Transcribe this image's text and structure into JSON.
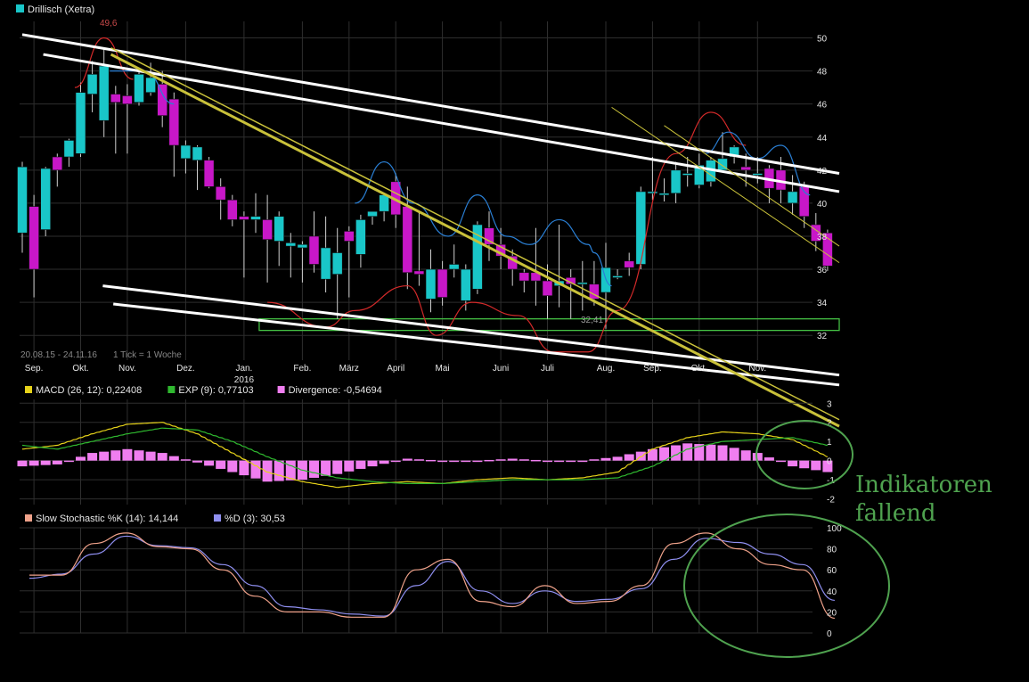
{
  "colors": {
    "background": "#000000",
    "grid": "#2e2e2e",
    "candle_up": "#19c6c8",
    "candle_down": "#c817c8",
    "wick": "#cfcfcf",
    "trendline_white": "#ffffff",
    "trendline_yellow": "#c9c13a",
    "support_box": "#44c044",
    "cycle_red": "#d42a2a",
    "cycle_blue": "#2a7fd4",
    "macd": "#e6d21a",
    "exp": "#2fb82f",
    "divergence": "#f07ef0",
    "stoch_k": "#f0a28a",
    "stoch_d": "#8f8ff0",
    "annotation": "#4fa24f"
  },
  "chart_data": [
    {
      "type": "candlestick",
      "title": "Drillisch (Xetra)",
      "legend_swatch_color": "#19c6c8",
      "period_label": "20.08.15 - 24.11.16",
      "tick_label": "1 Tick = 1 Woche",
      "price_note": "32,41",
      "high_note": "49,6",
      "ylim": [
        30.5,
        51
      ],
      "yticks": [
        32,
        34,
        36,
        38,
        40,
        42,
        44,
        46,
        48,
        50
      ],
      "xlabels": [
        {
          "week": 1,
          "label": "Sep."
        },
        {
          "week": 5,
          "label": "Okt."
        },
        {
          "week": 9,
          "label": "Nov."
        },
        {
          "week": 14,
          "label": "Dez."
        },
        {
          "week": 19,
          "label": "Jan."
        },
        {
          "week": 24,
          "label": "Feb."
        },
        {
          "week": 28,
          "label": "März"
        },
        {
          "week": 32,
          "label": "April"
        },
        {
          "week": 36,
          "label": "Mai"
        },
        {
          "week": 41,
          "label": "Juni"
        },
        {
          "week": 45,
          "label": "Juli"
        },
        {
          "week": 50,
          "label": "Aug."
        },
        {
          "week": 54,
          "label": "Sep."
        },
        {
          "week": 58,
          "label": "Okt."
        },
        {
          "week": 63,
          "label": "Nov."
        }
      ],
      "year_label": {
        "week": 19,
        "label": "2016"
      },
      "candles": [
        {
          "o": 38.2,
          "h": 42.5,
          "l": 37.0,
          "c": 42.2
        },
        {
          "o": 39.8,
          "h": 40.5,
          "l": 34.3,
          "c": 36.0
        },
        {
          "o": 38.4,
          "h": 42.2,
          "l": 38.0,
          "c": 42.1
        },
        {
          "o": 42.8,
          "h": 43.0,
          "l": 41.0,
          "c": 42.0
        },
        {
          "o": 42.8,
          "h": 43.9,
          "l": 42.2,
          "c": 43.8
        },
        {
          "o": 43.0,
          "h": 47.3,
          "l": 42.8,
          "c": 46.7
        },
        {
          "o": 46.6,
          "h": 48.6,
          "l": 45.5,
          "c": 47.8
        },
        {
          "o": 45.0,
          "h": 49.4,
          "l": 44.0,
          "c": 48.3
        },
        {
          "o": 46.6,
          "h": 47.1,
          "l": 43.0,
          "c": 46.1
        },
        {
          "o": 46.5,
          "h": 47.2,
          "l": 43.0,
          "c": 46.0
        },
        {
          "o": 46.1,
          "h": 48.2,
          "l": 45.9,
          "c": 47.8
        },
        {
          "o": 46.7,
          "h": 48.5,
          "l": 46.5,
          "c": 47.6
        },
        {
          "o": 47.2,
          "h": 48.0,
          "l": 44.6,
          "c": 45.3
        },
        {
          "o": 46.3,
          "h": 46.7,
          "l": 41.6,
          "c": 43.5
        },
        {
          "o": 42.7,
          "h": 43.8,
          "l": 41.8,
          "c": 43.5
        },
        {
          "o": 42.6,
          "h": 43.5,
          "l": 40.8,
          "c": 43.4
        },
        {
          "o": 42.6,
          "h": 42.8,
          "l": 40.9,
          "c": 41.0
        },
        {
          "o": 41.0,
          "h": 41.5,
          "l": 39.0,
          "c": 40.2
        },
        {
          "o": 40.2,
          "h": 40.5,
          "l": 38.6,
          "c": 39.0
        },
        {
          "o": 39.2,
          "h": 39.5,
          "l": 35.5,
          "c": 39.0
        },
        {
          "o": 39.0,
          "h": 40.6,
          "l": 38.2,
          "c": 39.2
        },
        {
          "o": 39.0,
          "h": 40.5,
          "l": 35.2,
          "c": 37.8
        },
        {
          "o": 37.7,
          "h": 39.5,
          "l": 36.2,
          "c": 39.2
        },
        {
          "o": 37.4,
          "h": 38.2,
          "l": 35.5,
          "c": 37.6
        },
        {
          "o": 37.3,
          "h": 37.7,
          "l": 35.2,
          "c": 37.5
        },
        {
          "o": 38.0,
          "h": 39.5,
          "l": 35.8,
          "c": 36.3
        },
        {
          "o": 35.4,
          "h": 39.2,
          "l": 34.6,
          "c": 37.3
        },
        {
          "o": 35.7,
          "h": 38.5,
          "l": 33.0,
          "c": 37.0
        },
        {
          "o": 38.3,
          "h": 38.6,
          "l": 34.3,
          "c": 37.7
        },
        {
          "o": 36.9,
          "h": 39.3,
          "l": 36.1,
          "c": 39.0
        },
        {
          "o": 39.2,
          "h": 39.5,
          "l": 38.7,
          "c": 39.5
        },
        {
          "o": 39.5,
          "h": 40.4,
          "l": 38.9,
          "c": 40.5
        },
        {
          "o": 41.3,
          "h": 41.8,
          "l": 38.5,
          "c": 39.3
        },
        {
          "o": 39.8,
          "h": 41.0,
          "l": 34.8,
          "c": 35.8
        },
        {
          "o": 35.9,
          "h": 39.5,
          "l": 35.0,
          "c": 35.7
        },
        {
          "o": 34.2,
          "h": 37.2,
          "l": 33.4,
          "c": 36.0
        },
        {
          "o": 36.0,
          "h": 36.5,
          "l": 33.8,
          "c": 34.3
        },
        {
          "o": 36.0,
          "h": 37.5,
          "l": 35.5,
          "c": 36.3
        },
        {
          "o": 34.1,
          "h": 36.3,
          "l": 33.5,
          "c": 36.0
        },
        {
          "o": 34.8,
          "h": 38.9,
          "l": 34.5,
          "c": 38.7
        },
        {
          "o": 38.5,
          "h": 39.5,
          "l": 36.5,
          "c": 37.5
        },
        {
          "o": 37.5,
          "h": 38.5,
          "l": 36.0,
          "c": 36.8
        },
        {
          "o": 36.8,
          "h": 37.2,
          "l": 35.0,
          "c": 36.0
        },
        {
          "o": 35.8,
          "h": 36.0,
          "l": 34.6,
          "c": 35.3
        },
        {
          "o": 35.8,
          "h": 38.5,
          "l": 33.8,
          "c": 35.3
        },
        {
          "o": 35.3,
          "h": 36.3,
          "l": 33.0,
          "c": 34.4
        },
        {
          "o": 35.0,
          "h": 38.7,
          "l": 33.7,
          "c": 35.3
        },
        {
          "o": 35.5,
          "h": 36.0,
          "l": 33.0,
          "c": 35.1
        },
        {
          "o": 35.2,
          "h": 36.5,
          "l": 33.5,
          "c": 35.2
        },
        {
          "o": 35.1,
          "h": 36.5,
          "l": 33.8,
          "c": 34.2
        },
        {
          "o": 34.6,
          "h": 37.6,
          "l": 32.4,
          "c": 36.1
        },
        {
          "o": 35.6,
          "h": 36.0,
          "l": 35.4,
          "c": 35.6
        },
        {
          "o": 36.5,
          "h": 37.0,
          "l": 35.6,
          "c": 36.1
        },
        {
          "o": 36.3,
          "h": 41.0,
          "l": 36.0,
          "c": 40.7
        },
        {
          "o": 40.6,
          "h": 42.8,
          "l": 40.2,
          "c": 40.7
        },
        {
          "o": 40.6,
          "h": 41.5,
          "l": 40.1,
          "c": 40.6
        },
        {
          "o": 40.6,
          "h": 42.5,
          "l": 40.0,
          "c": 42.0
        },
        {
          "o": 41.8,
          "h": 42.8,
          "l": 41.0,
          "c": 41.8
        },
        {
          "o": 41.1,
          "h": 43.0,
          "l": 40.9,
          "c": 42.3
        },
        {
          "o": 41.3,
          "h": 42.8,
          "l": 41.0,
          "c": 42.6
        },
        {
          "o": 42.0,
          "h": 44.3,
          "l": 41.9,
          "c": 42.7
        },
        {
          "o": 42.8,
          "h": 43.5,
          "l": 42.4,
          "c": 43.4
        },
        {
          "o": 42.2,
          "h": 43.0,
          "l": 41.0,
          "c": 42.0
        },
        {
          "o": 41.8,
          "h": 42.8,
          "l": 41.2,
          "c": 41.8
        },
        {
          "o": 42.1,
          "h": 42.3,
          "l": 40.0,
          "c": 40.9
        },
        {
          "o": 42.0,
          "h": 42.8,
          "l": 40.0,
          "c": 40.8
        },
        {
          "o": 40.0,
          "h": 41.7,
          "l": 39.3,
          "c": 40.7
        },
        {
          "o": 41.0,
          "h": 41.3,
          "l": 38.5,
          "c": 39.2
        },
        {
          "o": 38.7,
          "h": 39.4,
          "l": 37.1,
          "c": 37.7
        },
        {
          "o": 38.2,
          "h": 38.4,
          "l": 35.9,
          "c": 36.2
        }
      ],
      "trendlines_white": [
        {
          "from": {
            "week": 0.0,
            "v": 50.2
          },
          "to": {
            "week": 70.0,
            "v": 41.8
          }
        },
        {
          "from": {
            "week": 1.8,
            "v": 49.0
          },
          "to": {
            "week": 70.0,
            "v": 40.7
          }
        },
        {
          "from": {
            "week": 6.9,
            "v": 35.0
          },
          "to": {
            "week": 70.0,
            "v": 29.6
          }
        },
        {
          "from": {
            "week": 7.8,
            "v": 33.9
          },
          "to": {
            "week": 70.0,
            "v": 29.0
          }
        }
      ],
      "trendlines_yellow": [
        {
          "from": {
            "week": 7.6,
            "v": 49.0
          },
          "to": {
            "week": 70.0,
            "v": 26.5
          },
          "width": 3
        },
        {
          "from": {
            "week": 7.6,
            "v": 49.4
          },
          "to": {
            "week": 70.0,
            "v": 26.9
          },
          "width": 1.5
        },
        {
          "from": {
            "week": 50.5,
            "v": 45.8
          },
          "to": {
            "week": 70.0,
            "v": 36.4
          },
          "width": 1
        },
        {
          "from": {
            "week": 55.0,
            "v": 44.7
          },
          "to": {
            "week": 70.0,
            "v": 37.4
          },
          "width": 1
        }
      ],
      "support_zone": {
        "week_from": 20.3,
        "week_to": 70.0,
        "v_high": 33.0,
        "v_low": 32.3
      },
      "cycle_red": [
        {
          "week": 4.5,
          "v": 47.0
        },
        {
          "week": 7.0,
          "v": 50.0
        },
        {
          "week": 9.5,
          "v": 47.5
        },
        {
          "week": 21.0,
          "v": 34.0
        },
        {
          "week": 26.0,
          "v": 32.5
        },
        {
          "week": 28.5,
          "v": 33.5
        },
        {
          "week": 33.0,
          "v": 35.0
        },
        {
          "week": 35.5,
          "v": 32.0
        },
        {
          "week": 38.5,
          "v": 34.0
        },
        {
          "week": 42.5,
          "v": 33.2
        },
        {
          "week": 45.5,
          "v": 31.0
        },
        {
          "week": 48.5,
          "v": 31.0
        },
        {
          "week": 51.0,
          "v": 33.5
        },
        {
          "week": 56.0,
          "v": 43.0
        },
        {
          "week": 59.0,
          "v": 45.5
        },
        {
          "week": 62.0,
          "v": 43.5
        }
      ],
      "cycle_blue": [
        {
          "week": 7.5,
          "v": 48.0
        },
        {
          "week": 10.5,
          "v": 48.0
        },
        {
          "week": 13.0,
          "v": 46.0
        },
        {
          "week": 28.5,
          "v": 40.0
        },
        {
          "week": 31.0,
          "v": 42.5
        },
        {
          "week": 33.5,
          "v": 40.0
        },
        {
          "week": 36.5,
          "v": 38.0
        },
        {
          "week": 39.0,
          "v": 40.5
        },
        {
          "week": 41.5,
          "v": 38.0
        },
        {
          "week": 43.5,
          "v": 37.5
        },
        {
          "week": 46.0,
          "v": 39.0
        },
        {
          "week": 48.5,
          "v": 37.5
        },
        {
          "week": 49.0,
          "v": 37.0
        },
        {
          "week": 50.5,
          "v": 35.0
        },
        {
          "week": 58.5,
          "v": 43.0
        },
        {
          "week": 60.5,
          "v": 44.3
        },
        {
          "week": 63.0,
          "v": 42.7
        },
        {
          "week": 65.0,
          "v": 43.5
        },
        {
          "week": 67.5,
          "v": 40.5
        }
      ]
    },
    {
      "type": "line",
      "title": "MACD",
      "legend": [
        {
          "name": "MACD (26, 12): 0,22408",
          "color": "#e6d21a"
        },
        {
          "name": "EXP (9): 0,77103",
          "color": "#2fb82f"
        },
        {
          "name": "Divergence: -0,54694",
          "color": "#f07ef0"
        }
      ],
      "ylim": [
        -2.3,
        3.2
      ],
      "yticks": [
        -2,
        -1,
        0,
        1,
        2,
        3
      ],
      "x": [
        0,
        3,
        6,
        9,
        12,
        15,
        18,
        21,
        24,
        27,
        30,
        33,
        36,
        39,
        42,
        45,
        48,
        51,
        54,
        57,
        60,
        63,
        66,
        69
      ],
      "series": [
        {
          "name": "MACD",
          "values": [
            0.6,
            0.8,
            1.4,
            1.9,
            2.0,
            1.4,
            0.4,
            -0.6,
            -1.1,
            -1.4,
            -1.2,
            -1.1,
            -1.2,
            -1.0,
            -0.9,
            -1.0,
            -0.9,
            -0.6,
            0.6,
            1.2,
            1.5,
            1.4,
            1.1,
            0.2
          ]
        },
        {
          "name": "EXP",
          "values": [
            0.8,
            0.6,
            1.0,
            1.4,
            1.7,
            1.6,
            1.0,
            0.2,
            -0.5,
            -0.9,
            -1.1,
            -1.2,
            -1.2,
            -1.1,
            -1.0,
            -1.0,
            -1.0,
            -0.9,
            -0.3,
            0.6,
            1.0,
            1.1,
            1.2,
            0.8
          ]
        },
        {
          "name": "Divergence",
          "values": [
            -0.3,
            -0.2,
            0.4,
            0.6,
            0.4,
            -0.1,
            -0.6,
            -1.1,
            -1.0,
            -0.7,
            -0.3,
            0.1,
            0.0,
            0.0,
            0.1,
            0.0,
            0.0,
            0.2,
            0.6,
            0.9,
            0.8,
            0.4,
            -0.3,
            -0.6
          ]
        }
      ]
    },
    {
      "type": "line",
      "title": "Slow Stochastic",
      "legend": [
        {
          "name": "Slow Stochastic %K (14): 14,144",
          "color": "#f0a28a"
        },
        {
          "name": "%D (3): 30,53",
          "color": "#8f8ff0"
        }
      ],
      "ylim": [
        0,
        100
      ],
      "yticks": [
        0,
        20,
        40,
        60,
        80,
        100
      ],
      "x": [
        0,
        3,
        6,
        9,
        12,
        15,
        18,
        21,
        24,
        27,
        30,
        33,
        36,
        39,
        42,
        45,
        48,
        51,
        54,
        57,
        60,
        63,
        66,
        69
      ],
      "series": [
        {
          "name": "%K",
          "values": [
            55,
            55,
            85,
            95,
            82,
            80,
            60,
            35,
            20,
            20,
            15,
            15,
            60,
            70,
            30,
            25,
            45,
            28,
            30,
            45,
            85,
            95,
            80,
            65,
            60,
            14
          ]
        },
        {
          "name": "%D",
          "values": [
            52,
            56,
            75,
            92,
            83,
            81,
            65,
            45,
            25,
            22,
            18,
            16,
            45,
            68,
            40,
            28,
            40,
            30,
            32,
            42,
            70,
            90,
            86,
            75,
            65,
            31
          ]
        }
      ]
    }
  ],
  "annotation": {
    "line1": "Indikatoren",
    "line2": "fallend"
  }
}
